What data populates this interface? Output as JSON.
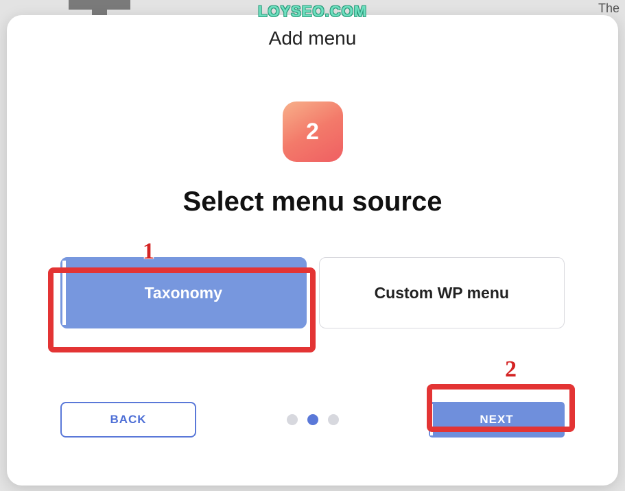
{
  "watermark": "LOYSEO.COM",
  "background": {
    "partial_text": "The"
  },
  "modal": {
    "title": "Add menu",
    "step_number": "2",
    "heading": "Select menu source",
    "options": [
      {
        "label": "Taxonomy",
        "selected": true
      },
      {
        "label": "Custom WP menu",
        "selected": false
      }
    ],
    "back_label": "BACK",
    "next_label": "NEXT",
    "progress": {
      "total": 3,
      "active_index": 1
    }
  },
  "annotations": [
    {
      "number": "1",
      "target": "option-taxonomy"
    },
    {
      "number": "2",
      "target": "next-button"
    }
  ]
}
